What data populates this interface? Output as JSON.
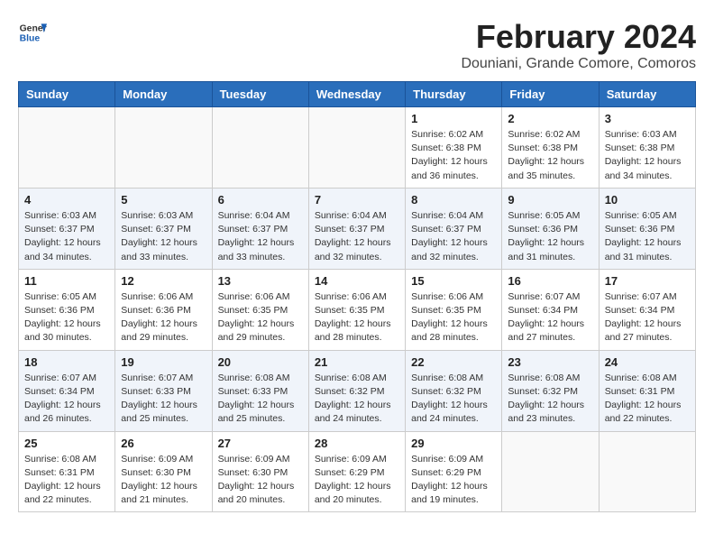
{
  "logo": {
    "line1": "General",
    "line2": "Blue"
  },
  "title": "February 2024",
  "location": "Douniani, Grande Comore, Comoros",
  "days_of_week": [
    "Sunday",
    "Monday",
    "Tuesday",
    "Wednesday",
    "Thursday",
    "Friday",
    "Saturday"
  ],
  "weeks": [
    [
      {
        "day": "",
        "info": ""
      },
      {
        "day": "",
        "info": ""
      },
      {
        "day": "",
        "info": ""
      },
      {
        "day": "",
        "info": ""
      },
      {
        "day": "1",
        "info": "Sunrise: 6:02 AM\nSunset: 6:38 PM\nDaylight: 12 hours\nand 36 minutes."
      },
      {
        "day": "2",
        "info": "Sunrise: 6:02 AM\nSunset: 6:38 PM\nDaylight: 12 hours\nand 35 minutes."
      },
      {
        "day": "3",
        "info": "Sunrise: 6:03 AM\nSunset: 6:38 PM\nDaylight: 12 hours\nand 34 minutes."
      }
    ],
    [
      {
        "day": "4",
        "info": "Sunrise: 6:03 AM\nSunset: 6:37 PM\nDaylight: 12 hours\nand 34 minutes."
      },
      {
        "day": "5",
        "info": "Sunrise: 6:03 AM\nSunset: 6:37 PM\nDaylight: 12 hours\nand 33 minutes."
      },
      {
        "day": "6",
        "info": "Sunrise: 6:04 AM\nSunset: 6:37 PM\nDaylight: 12 hours\nand 33 minutes."
      },
      {
        "day": "7",
        "info": "Sunrise: 6:04 AM\nSunset: 6:37 PM\nDaylight: 12 hours\nand 32 minutes."
      },
      {
        "day": "8",
        "info": "Sunrise: 6:04 AM\nSunset: 6:37 PM\nDaylight: 12 hours\nand 32 minutes."
      },
      {
        "day": "9",
        "info": "Sunrise: 6:05 AM\nSunset: 6:36 PM\nDaylight: 12 hours\nand 31 minutes."
      },
      {
        "day": "10",
        "info": "Sunrise: 6:05 AM\nSunset: 6:36 PM\nDaylight: 12 hours\nand 31 minutes."
      }
    ],
    [
      {
        "day": "11",
        "info": "Sunrise: 6:05 AM\nSunset: 6:36 PM\nDaylight: 12 hours\nand 30 minutes."
      },
      {
        "day": "12",
        "info": "Sunrise: 6:06 AM\nSunset: 6:36 PM\nDaylight: 12 hours\nand 29 minutes."
      },
      {
        "day": "13",
        "info": "Sunrise: 6:06 AM\nSunset: 6:35 PM\nDaylight: 12 hours\nand 29 minutes."
      },
      {
        "day": "14",
        "info": "Sunrise: 6:06 AM\nSunset: 6:35 PM\nDaylight: 12 hours\nand 28 minutes."
      },
      {
        "day": "15",
        "info": "Sunrise: 6:06 AM\nSunset: 6:35 PM\nDaylight: 12 hours\nand 28 minutes."
      },
      {
        "day": "16",
        "info": "Sunrise: 6:07 AM\nSunset: 6:34 PM\nDaylight: 12 hours\nand 27 minutes."
      },
      {
        "day": "17",
        "info": "Sunrise: 6:07 AM\nSunset: 6:34 PM\nDaylight: 12 hours\nand 27 minutes."
      }
    ],
    [
      {
        "day": "18",
        "info": "Sunrise: 6:07 AM\nSunset: 6:34 PM\nDaylight: 12 hours\nand 26 minutes."
      },
      {
        "day": "19",
        "info": "Sunrise: 6:07 AM\nSunset: 6:33 PM\nDaylight: 12 hours\nand 25 minutes."
      },
      {
        "day": "20",
        "info": "Sunrise: 6:08 AM\nSunset: 6:33 PM\nDaylight: 12 hours\nand 25 minutes."
      },
      {
        "day": "21",
        "info": "Sunrise: 6:08 AM\nSunset: 6:32 PM\nDaylight: 12 hours\nand 24 minutes."
      },
      {
        "day": "22",
        "info": "Sunrise: 6:08 AM\nSunset: 6:32 PM\nDaylight: 12 hours\nand 24 minutes."
      },
      {
        "day": "23",
        "info": "Sunrise: 6:08 AM\nSunset: 6:32 PM\nDaylight: 12 hours\nand 23 minutes."
      },
      {
        "day": "24",
        "info": "Sunrise: 6:08 AM\nSunset: 6:31 PM\nDaylight: 12 hours\nand 22 minutes."
      }
    ],
    [
      {
        "day": "25",
        "info": "Sunrise: 6:08 AM\nSunset: 6:31 PM\nDaylight: 12 hours\nand 22 minutes."
      },
      {
        "day": "26",
        "info": "Sunrise: 6:09 AM\nSunset: 6:30 PM\nDaylight: 12 hours\nand 21 minutes."
      },
      {
        "day": "27",
        "info": "Sunrise: 6:09 AM\nSunset: 6:30 PM\nDaylight: 12 hours\nand 20 minutes."
      },
      {
        "day": "28",
        "info": "Sunrise: 6:09 AM\nSunset: 6:29 PM\nDaylight: 12 hours\nand 20 minutes."
      },
      {
        "day": "29",
        "info": "Sunrise: 6:09 AM\nSunset: 6:29 PM\nDaylight: 12 hours\nand 19 minutes."
      },
      {
        "day": "",
        "info": ""
      },
      {
        "day": "",
        "info": ""
      }
    ]
  ]
}
